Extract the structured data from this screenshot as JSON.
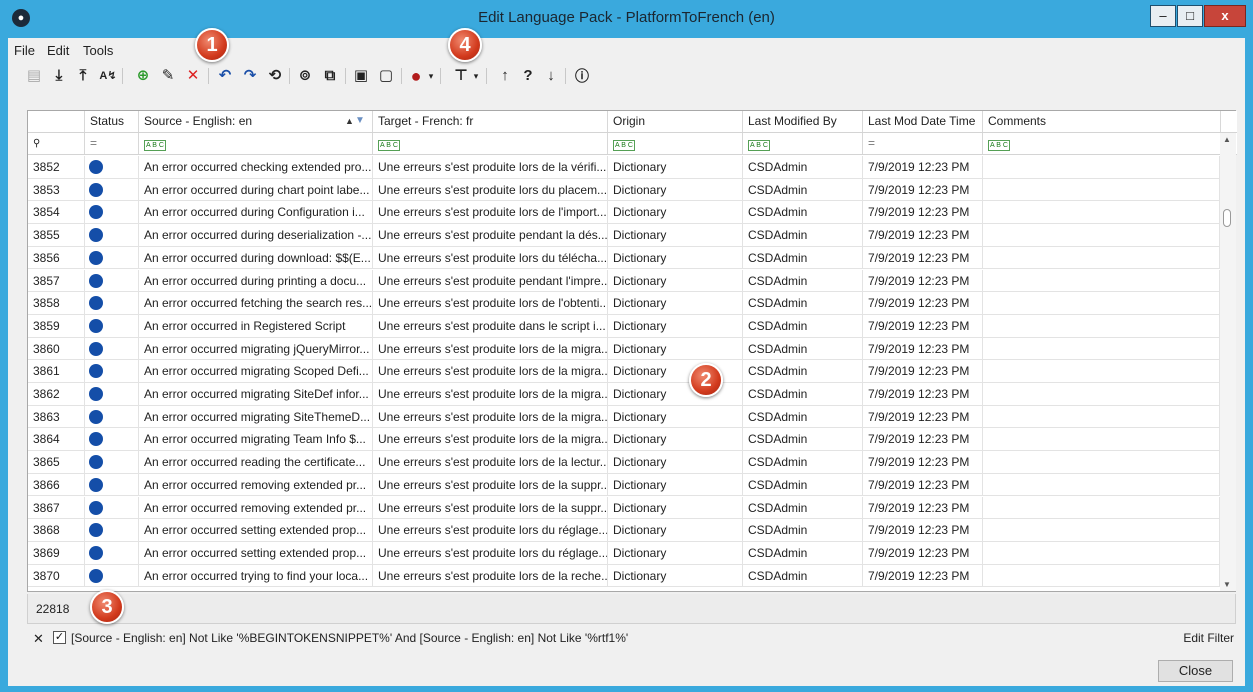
{
  "window": {
    "title": "Edit Language Pack - PlatformToFrench (en)",
    "minimize_glyph": "–",
    "maximize_glyph": "□",
    "close_glyph": "x",
    "app_icon": "app-logo-icon"
  },
  "menu": {
    "file": "File",
    "edit": "Edit",
    "tools": "Tools"
  },
  "toolbar": {
    "icons": [
      "save-icon",
      "import-icon",
      "export-icon",
      "translate-icon",
      "add-icon",
      "edit-icon",
      "delete-icon",
      "undo-icon",
      "redo-icon",
      "history-icon",
      "find-icon",
      "copy-icon",
      "lock-icon",
      "unlock-icon",
      "status-color-icon",
      "dropdown-icon",
      "filter-icon",
      "dropdown-icon",
      "move-up-icon",
      "help-icon",
      "move-down-icon",
      "info-icon"
    ]
  },
  "callouts": [
    "1",
    "2",
    "3",
    "4"
  ],
  "grid": {
    "columns": [
      "Status",
      "Source - English: en",
      "Target - French: fr",
      "Origin",
      "Last Modified By",
      "Last Mod Date Time",
      "Comments"
    ],
    "filter_row_equals": "=",
    "filter_row_abc": "A B C",
    "rows": [
      {
        "id": "3852",
        "source": "An error occurred checking extended pro...",
        "target": "Une erreurs s'est produite lors de la vérifi...",
        "origin": "Dictionary",
        "modified_by": "CSDAdmin",
        "date": "7/9/2019 12:23 PM",
        "comments": ""
      },
      {
        "id": "3853",
        "source": "An error occurred during chart point labe...",
        "target": "Une erreurs s'est produite lors du placem...",
        "origin": "Dictionary",
        "modified_by": "CSDAdmin",
        "date": "7/9/2019 12:23 PM",
        "comments": ""
      },
      {
        "id": "3854",
        "source": "An error occurred during Configuration i...",
        "target": "Une erreurs s'est produite lors de l'import...",
        "origin": "Dictionary",
        "modified_by": "CSDAdmin",
        "date": "7/9/2019 12:23 PM",
        "comments": ""
      },
      {
        "id": "3855",
        "source": "An error occurred during deserialization -...",
        "target": "Une erreurs s'est produite pendant la dés...",
        "origin": "Dictionary",
        "modified_by": "CSDAdmin",
        "date": "7/9/2019 12:23 PM",
        "comments": ""
      },
      {
        "id": "3856",
        "source": "An error occurred during download: $$(E...",
        "target": "Une erreurs s'est produite lors du télécha...",
        "origin": "Dictionary",
        "modified_by": "CSDAdmin",
        "date": "7/9/2019 12:23 PM",
        "comments": ""
      },
      {
        "id": "3857",
        "source": "An error occurred during printing a docu...",
        "target": "Une erreurs s'est produite pendant l'impre...",
        "origin": "Dictionary",
        "modified_by": "CSDAdmin",
        "date": "7/9/2019 12:23 PM",
        "comments": ""
      },
      {
        "id": "3858",
        "source": "An error occurred fetching the search res...",
        "target": "Une erreurs s'est produite lors de l'obtenti...",
        "origin": "Dictionary",
        "modified_by": "CSDAdmin",
        "date": "7/9/2019 12:23 PM",
        "comments": ""
      },
      {
        "id": "3859",
        "source": "An error occurred in Registered Script",
        "target": "Une erreurs s'est produite dans le script i...",
        "origin": "Dictionary",
        "modified_by": "CSDAdmin",
        "date": "7/9/2019 12:23 PM",
        "comments": ""
      },
      {
        "id": "3860",
        "source": "An error occurred migrating jQueryMirror...",
        "target": "Une erreurs s'est produite lors de la migra...",
        "origin": "Dictionary",
        "modified_by": "CSDAdmin",
        "date": "7/9/2019 12:23 PM",
        "comments": ""
      },
      {
        "id": "3861",
        "source": "An error occurred migrating Scoped Defi...",
        "target": "Une erreurs s'est produite lors de la migra...",
        "origin": "Dictionary",
        "modified_by": "CSDAdmin",
        "date": "7/9/2019 12:23 PM",
        "comments": ""
      },
      {
        "id": "3862",
        "source": "An error occurred migrating SiteDef infor...",
        "target": "Une erreurs s'est produite lors de la migra...",
        "origin": "Dictionary",
        "modified_by": "CSDAdmin",
        "date": "7/9/2019 12:23 PM",
        "comments": ""
      },
      {
        "id": "3863",
        "source": "An error occurred migrating SiteThemeD...",
        "target": "Une erreurs s'est produite lors de la migra...",
        "origin": "Dictionary",
        "modified_by": "CSDAdmin",
        "date": "7/9/2019 12:23 PM",
        "comments": ""
      },
      {
        "id": "3864",
        "source": "An error occurred migrating Team Info $...",
        "target": "Une erreurs s'est produite lors de la migra...",
        "origin": "Dictionary",
        "modified_by": "CSDAdmin",
        "date": "7/9/2019 12:23 PM",
        "comments": ""
      },
      {
        "id": "3865",
        "source": "An error occurred reading the certificate...",
        "target": "Une erreurs s'est produite lors de la lectur...",
        "origin": "Dictionary",
        "modified_by": "CSDAdmin",
        "date": "7/9/2019 12:23 PM",
        "comments": ""
      },
      {
        "id": "3866",
        "source": "An error occurred removing extended pr...",
        "target": "Une erreurs s'est produite lors de la suppr...",
        "origin": "Dictionary",
        "modified_by": "CSDAdmin",
        "date": "7/9/2019 12:23 PM",
        "comments": ""
      },
      {
        "id": "3867",
        "source": "An error occurred removing extended pr...",
        "target": "Une erreurs s'est produite lors de la suppr...",
        "origin": "Dictionary",
        "modified_by": "CSDAdmin",
        "date": "7/9/2019 12:23 PM",
        "comments": ""
      },
      {
        "id": "3868",
        "source": "An error occurred setting extended prop...",
        "target": "Une erreurs s'est produite lors du réglage...",
        "origin": "Dictionary",
        "modified_by": "CSDAdmin",
        "date": "7/9/2019 12:23 PM",
        "comments": ""
      },
      {
        "id": "3869",
        "source": "An error occurred setting extended prop...",
        "target": "Une erreurs s'est produite lors du réglage...",
        "origin": "Dictionary",
        "modified_by": "CSDAdmin",
        "date": "7/9/2019 12:23 PM",
        "comments": ""
      },
      {
        "id": "3870",
        "source": "An error occurred trying to find your loca...",
        "target": "Une erreurs s'est produite lors de la reche...",
        "origin": "Dictionary",
        "modified_by": "CSDAdmin",
        "date": "7/9/2019 12:23 PM",
        "comments": ""
      }
    ]
  },
  "footer": {
    "count": "22818",
    "filter_text": "[Source - English: en] Not Like '%BEGINTOKENSNIPPET%' And [Source - English: en] Not Like '%rtf1%'",
    "filter_checked": "✓",
    "filter_clear": "✕",
    "edit_filter": "Edit Filter",
    "close": "Close"
  },
  "colors": {
    "window_frame": "#3aa9dd",
    "status_dot": "#144ea8",
    "callout": "#d23a1d"
  }
}
